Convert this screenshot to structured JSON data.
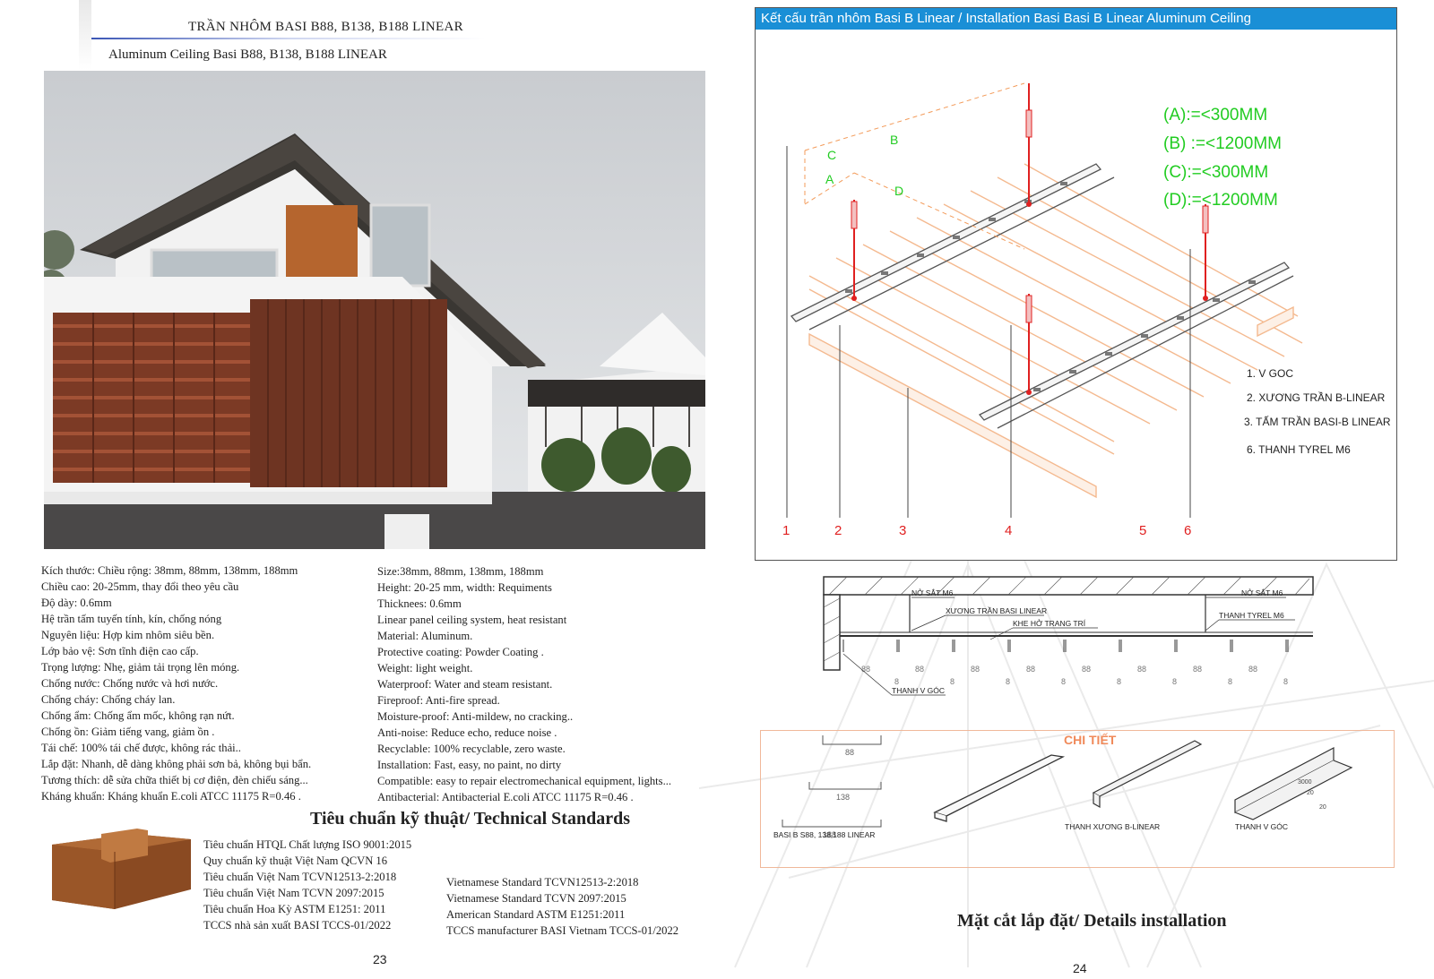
{
  "left_page": {
    "title": "TRẦN  NHÔM BASI B88, B138, B188 LINEAR",
    "subtitle": "Aluminum Ceiling Basi B88, B138, B188 LINEAR",
    "specs_vi": [
      "Kích thước: Chiều rộng: 38mm, 88mm, 138mm, 188mm",
      "Chiều cao: 20-25mm, thay đổi theo yêu cầu",
      "Độ dày: 0.6mm",
      "Hệ trần tấm tuyến tính, kín, chống nóng",
      "Nguyên liệu: Hợp kim nhôm siêu bền.",
      "Lớp bảo vệ: Sơn tĩnh điện cao cấp.",
      "Trọng lượng: Nhẹ, giảm tải trọng lên móng.",
      "Chống nước: Chống nước và hơi nước.",
      "Chống cháy: Chống cháy lan.",
      "Chống ẩm: Chống ẩm mốc, không rạn nứt.",
      "Chống ồn: Giảm tiếng vang, giảm ồn .",
      "Tái chế: 100% tái chế được, không rác thải..",
      "Lắp đặt: Nhanh, dễ dàng không phải sơn bả, không bụi bẩn.",
      "Tương thích: dễ sửa chữa thiết bị cơ điện, đèn chiếu sáng...",
      "Kháng khuẩn: Kháng khuẩn E.coli ATCC 11175 R=0.46 ."
    ],
    "specs_en": [
      "Size:38mm, 88mm, 138mm, 188mm",
      "Height: 20-25 mm, width: Requiments",
      "Thicknees: 0.6mm",
      "Linear panel ceiling system, heat resistant",
      "Material: Aluminum.",
      "Protective coating: Powder Coating .",
      "Weight: light weight.",
      "Waterproof: Water and steam resistant.",
      "Fireproof: Anti-fire spread.",
      "Moisture-proof: Anti-mildew, no cracking..",
      "Anti-noise: Reduce echo, reduce noise .",
      "Recyclable: 100% recyclable, zero waste.",
      "Installation: Fast, easy, no paint, no dirty",
      "Compatible: easy to repair electromechanical equipment, lights...",
      "Antibacterial: Antibacterial E.coli ATCC 11175 R=0.46 ."
    ],
    "standards_heading": "Tiêu chuẩn kỹ thuật/  Technical Standards",
    "standards_vi": [
      "Tiêu chuẩn HTQL Chất lượng ISO 9001:2015",
      "Quy chuẩn kỹ thuật Việt Nam QCVN 16",
      "Tiêu chuẩn Việt Nam TCVN12513-2:2018",
      "Tiêu chuẩn Việt Nam TCVN 2097:2015",
      "Tiêu chuẩn Hoa Kỳ ASTM E1251: 2011",
      "TCCS nhà sản xuất BASI TCCS-01/2022"
    ],
    "standards_en": [
      "Vietnamese Standard TCVN12513-2:2018",
      "Vietnamese Standard TCVN 2097:2015",
      "American Standard ASTM E1251:2011",
      "TCCS manufacturer BASI Vietnam TCCS-01/2022"
    ],
    "page_number": "23"
  },
  "right_page": {
    "diagram_title": "Kết cấu trần nhôm Basi B Linear / Installation Basi  Basi B Linear  Aluminum Ceiling",
    "dimension_labels": [
      "(A):=<300MM",
      "(B) :=<1200MM",
      "(C):=<300MM",
      "(D):=<1200MM"
    ],
    "axis_letters": [
      "C",
      "B",
      "A",
      "D"
    ],
    "legend": [
      "1. V GOC",
      "2. XƯƠNG TRẦN B-LINEAR",
      "3. TẤM TRẦN BASI-B LINEAR",
      "6. THANH TYREL M6"
    ],
    "callout_numbers": [
      "1",
      "2",
      "3",
      "4",
      "5",
      "6"
    ],
    "section_labels": {
      "anchor_left": "NỞ SẮT M6",
      "anchor_right": "NỞ SẮT M6",
      "carrier": "XƯƠNG TRẦN BASI LINEAR",
      "gap": "KHE HỞ TRANG TRÍ",
      "rod": "THANH TYREL M6",
      "angle": "THANH V GÓC",
      "dims": [
        "88",
        "88",
        "88",
        "88",
        "88",
        "88",
        "88",
        "88"
      ],
      "gaps": [
        "8",
        "8",
        "8",
        "8",
        "8",
        "8",
        "8",
        "8"
      ]
    },
    "detail": {
      "title": "CHI TIẾT",
      "profile_widths": [
        "88",
        "138",
        "188"
      ],
      "profile_caption": "BASI B S88, 138,188 LINEAR",
      "carrier_caption": "THANH XƯƠNG B-LINEAR",
      "angle_caption": "THANH V GÓC",
      "angle_dims": [
        "3000",
        "20",
        "20"
      ]
    },
    "caption": "Mặt cắt lắp đặt/ Details installation",
    "page_number": "24"
  },
  "colors": {
    "header_blue": "#1a8fd6",
    "dimension_green": "#22cc22",
    "callout_red": "#e02020",
    "panel_salmon": "#f4b98f",
    "detail_orange": "#f08a5a"
  }
}
